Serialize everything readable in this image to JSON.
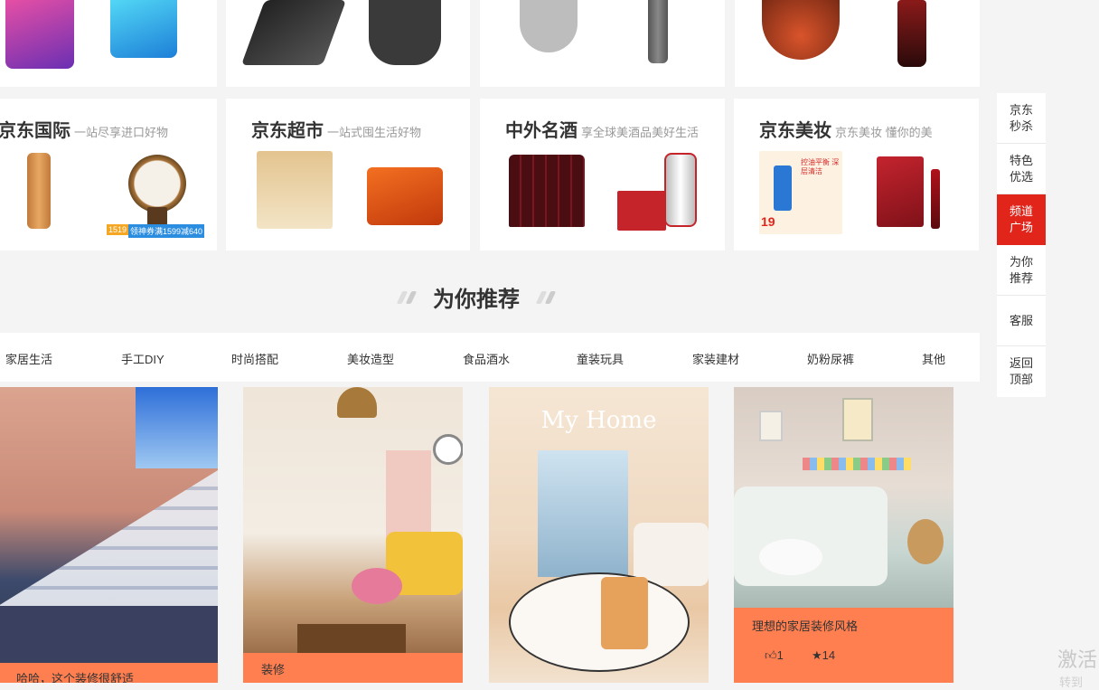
{
  "channels": [
    {
      "title": "京东国际",
      "subtitle": "一站尽享进口好物"
    },
    {
      "title": "京东超市",
      "subtitle": "一站式囤生活好物"
    },
    {
      "title": "中外名酒",
      "subtitle": "享全球美酒品美好生活"
    },
    {
      "title": "京东美妆",
      "subtitle": "京东美妆 懂你的美"
    }
  ],
  "section": {
    "title": "为你推荐"
  },
  "categories": [
    "家居生活",
    "手工DIY",
    "时尚搭配",
    "美妆造型",
    "食品酒水",
    "童装玩具",
    "家装建材",
    "奶粉尿裤",
    "其他"
  ],
  "feed": [
    {
      "title": "哈哈，这个装修很舒适"
    },
    {
      "title": "装修"
    },
    {
      "title": ""
    },
    {
      "title": "理想的家居装修风格",
      "likes": "1",
      "stars": "14"
    }
  ],
  "feed_image_texts": {
    "myhome": "My Home"
  },
  "product_badges": {
    "price_small": "1519",
    "price_promo": "领神券满1599减640",
    "price_beauty": "19",
    "beauty_tag": "控油平衡 深层清洁"
  },
  "elevator": [
    {
      "label": "京东秒杀",
      "active": false
    },
    {
      "label": "特色优选",
      "active": false
    },
    {
      "label": "频道广场",
      "active": true
    },
    {
      "label": "为你推荐",
      "active": false
    },
    {
      "label": "客服",
      "active": false
    },
    {
      "label": "返回顶部",
      "active": false
    }
  ],
  "watermark": {
    "main": "激活",
    "sub": "转到"
  },
  "colors": {
    "accent_red": "#e1251b",
    "feed_orange": "#ff7f50",
    "background": "#f4f4f4"
  },
  "icons": {
    "like": "thumbs-up-icon",
    "star": "star-icon"
  }
}
